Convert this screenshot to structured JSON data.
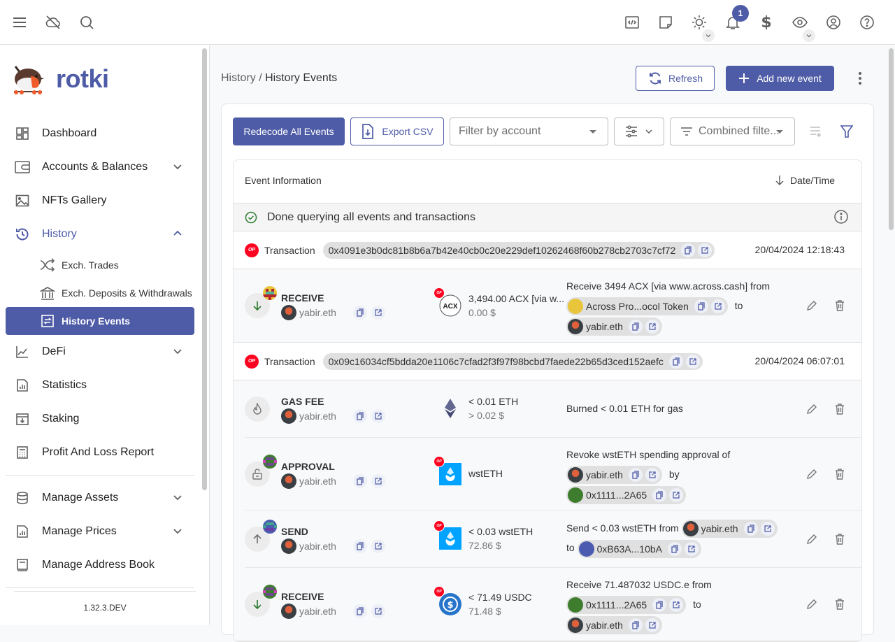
{
  "appbar": {
    "left_icons": [
      "menu-icon",
      "cloud-off-icon",
      "search-icon"
    ],
    "right_icons": [
      "code-icon",
      "note-icon",
      "theme-icon",
      "notification-icon",
      "currency-icon",
      "privacy-icon",
      "account-icon",
      "help-icon"
    ],
    "notification_count": "1"
  },
  "brand": {
    "name": "rotki"
  },
  "sidebar": {
    "items": [
      {
        "label": "Dashboard",
        "icon": "dashboard-icon"
      },
      {
        "label": "Accounts & Balances",
        "icon": "wallet-icon",
        "expandable": true
      },
      {
        "label": "NFTs Gallery",
        "icon": "image-icon"
      },
      {
        "label": "History",
        "icon": "history-icon",
        "expanded": true,
        "children": [
          {
            "label": "Exch. Trades",
            "icon": "shuffle-icon"
          },
          {
            "label": "Exch. Deposits & Withdrawals",
            "icon": "bank-icon"
          },
          {
            "label": "History Events",
            "icon": "exchange-box-icon",
            "selected": true
          }
        ]
      },
      {
        "label": "DeFi",
        "icon": "chart-line-icon",
        "expandable": true
      },
      {
        "label": "Statistics",
        "icon": "bar-chart-icon"
      },
      {
        "label": "Staking",
        "icon": "archive-icon"
      },
      {
        "label": "Profit And Loss Report",
        "icon": "calculator-icon"
      },
      {
        "label": "Manage Assets",
        "icon": "database-icon",
        "expandable": true
      },
      {
        "label": "Manage Prices",
        "icon": "bar-chart-icon",
        "expandable": true
      },
      {
        "label": "Manage Address Book",
        "icon": "book-icon"
      }
    ],
    "version": "1.32.3.DEV"
  },
  "header": {
    "breadcrumb_parent": "History",
    "breadcrumb_sep": " / ",
    "breadcrumb_current": "History Events",
    "refresh_label": "Refresh",
    "add_label": "Add new event"
  },
  "toolbar": {
    "redecode_label": "Redecode All Events",
    "export_label": "Export CSV",
    "account_placeholder": "Filter by account",
    "combined_placeholder": "Combined filte..."
  },
  "table": {
    "col_event": "Event Information",
    "col_date": "Date/Time",
    "status_text": "Done querying all events and transactions",
    "transactions": [
      {
        "label": "Transaction",
        "hash": "0x4091e3b0dc81b8b6a7b42e40cb0c20e229def10262468f60b278cb2703c7cf72",
        "date": "20/04/2024 12:18:43",
        "events": [
          {
            "type": "RECEIVE",
            "account": "yabir.eth",
            "asset_symbol": "ACX",
            "amount": "3,494.00 ACX [via w...",
            "usd": "0.00 $",
            "note_prefix": "Receive 3494 ACX [via www.across.cash] from",
            "chip1": "Across Pro...ocol Token",
            "note_mid": "to",
            "chip2": "yabir.eth"
          }
        ]
      },
      {
        "label": "Transaction",
        "hash": "0x09c16034cf5bdda20e1106c7cfad2f3f97f98bcbd7faede22b65d3ced152aefc",
        "date": "20/04/2024 06:07:01",
        "events": [
          {
            "type": "GAS FEE",
            "account": "yabir.eth",
            "asset_symbol": "ETH",
            "amount": "< 0.01 ETH",
            "usd": "> 0.02 $",
            "note": "Burned < 0.01 ETH for gas"
          },
          {
            "type": "APPROVAL",
            "account": "yabir.eth",
            "asset_symbol": "wstETH",
            "amount": "wstETH",
            "note_prefix": "Revoke wstETH spending approval of",
            "chip1": "yabir.eth",
            "note_mid": "by",
            "chip2": "0x1111...2A65"
          },
          {
            "type": "SEND",
            "account": "yabir.eth",
            "asset_symbol": "wstETH",
            "amount": "< 0.03 wstETH",
            "usd": "72.86 $",
            "note_prefix": "Send < 0.03 wstETH from",
            "chip1": "yabir.eth",
            "note_mid": "to",
            "chip2": "0xB63A...10bA"
          },
          {
            "type": "RECEIVE",
            "account": "yabir.eth",
            "asset_symbol": "USDC",
            "amount": "< 71.49 USDC",
            "usd": "71.48 $",
            "note_prefix": "Receive 71.487032 USDC.e from",
            "chip1": "0x1111...2A65",
            "note_mid": "to",
            "chip2": "yabir.eth"
          }
        ]
      }
    ]
  },
  "colors": {
    "primary": "#4e5ba6",
    "optimism": "#ff0420",
    "success": "#2e7d32",
    "wsteth": "#00a3ff",
    "usdc": "#2775ca"
  }
}
